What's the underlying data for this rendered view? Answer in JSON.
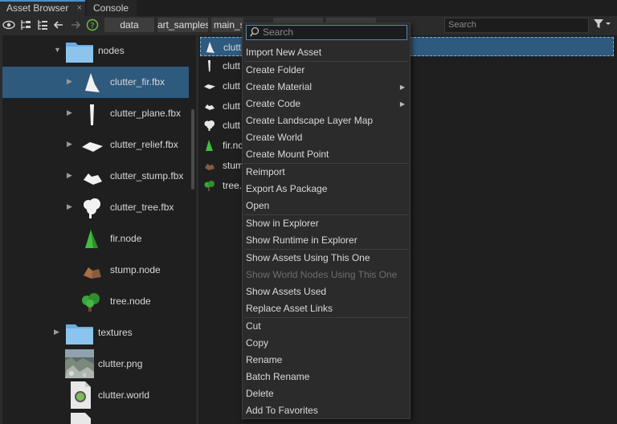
{
  "tabs": [
    {
      "label": "Asset Browser",
      "close": "×"
    },
    {
      "label": "Console"
    }
  ],
  "toolbar": {
    "breadcrumbs": [
      "data",
      "art_samples",
      "main_s",
      "",
      ""
    ],
    "search_placeholder": "Search",
    "icons": [
      "eye-icon",
      "collapse-tree-icon",
      "expand-tree-icon",
      "back-arrow-icon",
      "forward-arrow-icon",
      "help-icon",
      "filter-icon"
    ]
  },
  "tree": {
    "items": [
      {
        "label": "nodes",
        "icon": "folder-icon"
      },
      {
        "label": "clutter_fir.fbx",
        "icon": "fir-mesh-icon"
      },
      {
        "label": "clutter_plane.fbx",
        "icon": "plane-mesh-icon"
      },
      {
        "label": "clutter_relief.fbx",
        "icon": "relief-mesh-icon"
      },
      {
        "label": "clutter_stump.fbx",
        "icon": "stump-mesh-icon"
      },
      {
        "label": "clutter_tree.fbx",
        "icon": "tree-mesh-icon"
      },
      {
        "label": "fir.node",
        "icon": "fir-node-icon"
      },
      {
        "label": "stump.node",
        "icon": "stump-node-icon"
      },
      {
        "label": "tree.node",
        "icon": "tree-node-icon"
      },
      {
        "label": "textures",
        "icon": "folder-icon"
      },
      {
        "label": "clutter.png",
        "icon": "image-thumbnail-icon"
      },
      {
        "label": "clutter.world",
        "icon": "world-file-icon"
      }
    ]
  },
  "list": {
    "items": [
      "clutt",
      "clutt",
      "clutt",
      "clutt",
      "clutt",
      "fir.nc",
      "stum",
      "tree."
    ]
  },
  "menu": {
    "search_placeholder": "Search",
    "items": [
      {
        "label": "Import New Asset"
      },
      {
        "label": "Create Folder"
      },
      {
        "label": "Create Material",
        "sub": "▶"
      },
      {
        "label": "Create Code",
        "sub": "▶"
      },
      {
        "label": "Create Landscape Layer Map"
      },
      {
        "label": "Create World"
      },
      {
        "label": "Create Mount Point"
      },
      {
        "label": "Reimport"
      },
      {
        "label": "Export As Package"
      },
      {
        "label": "Open"
      },
      {
        "label": "Show in Explorer"
      },
      {
        "label": "Show Runtime in Explorer"
      },
      {
        "label": "Show Assets Using This One"
      },
      {
        "label": "Show World Nodes Using This One",
        "disabled": true
      },
      {
        "label": "Show Assets Used"
      },
      {
        "label": "Replace Asset Links"
      },
      {
        "label": "Cut"
      },
      {
        "label": "Copy"
      },
      {
        "label": "Rename"
      },
      {
        "label": "Batch Rename"
      },
      {
        "label": "Delete"
      },
      {
        "label": "Add To Favorites"
      }
    ]
  },
  "colors": {
    "accent": "#4a90c8",
    "selection": "#2e5a7e",
    "folder": "#6aaee0",
    "green_node": "#3fbf3f",
    "stump_brown": "#8a5a3c"
  }
}
